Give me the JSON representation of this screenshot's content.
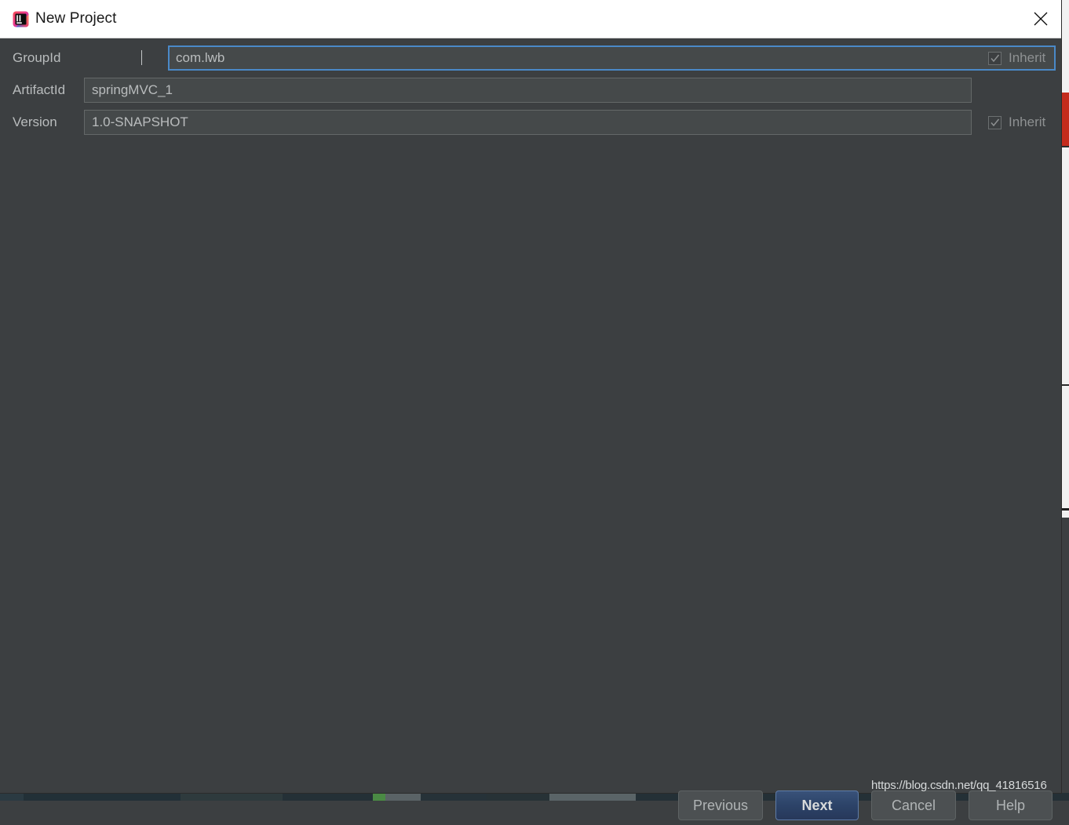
{
  "window": {
    "title": "New Project",
    "app_icon": "intellij-idea-logo-icon",
    "close_icon": "close-icon"
  },
  "form": {
    "fields": [
      {
        "label": "GroupId",
        "value": "com.lwb",
        "placeholder": "",
        "focused": true,
        "has_inherit": true,
        "inherit_label": "Inherit",
        "inherit_checked": true
      },
      {
        "label": "ArtifactId",
        "value": "springMVC_1",
        "placeholder": "",
        "focused": false,
        "has_inherit": false,
        "inherit_label": "",
        "inherit_checked": false
      },
      {
        "label": "Version",
        "value": "1.0-SNAPSHOT",
        "placeholder": "",
        "focused": false,
        "has_inherit": true,
        "inherit_label": "Inherit",
        "inherit_checked": true
      }
    ]
  },
  "buttons": {
    "previous": "Previous",
    "next": "Next",
    "cancel": "Cancel",
    "help": "Help"
  },
  "watermark": {
    "text": "https://blog.csdn.net/qq_41816516"
  },
  "colors": {
    "dialog_background": "#3c3f41",
    "titlebar_background": "#ffffff",
    "input_background": "#45494a",
    "input_border": "#646868",
    "focus_border": "#4a89c8",
    "label_text": "#b9bcbd",
    "primary_button": "#2c4368",
    "primary_button_border": "#5f7ca8",
    "button_background": "#4c5052",
    "backdrop_red": "#c42b1c",
    "taskbar_green": "#4a8a44"
  }
}
